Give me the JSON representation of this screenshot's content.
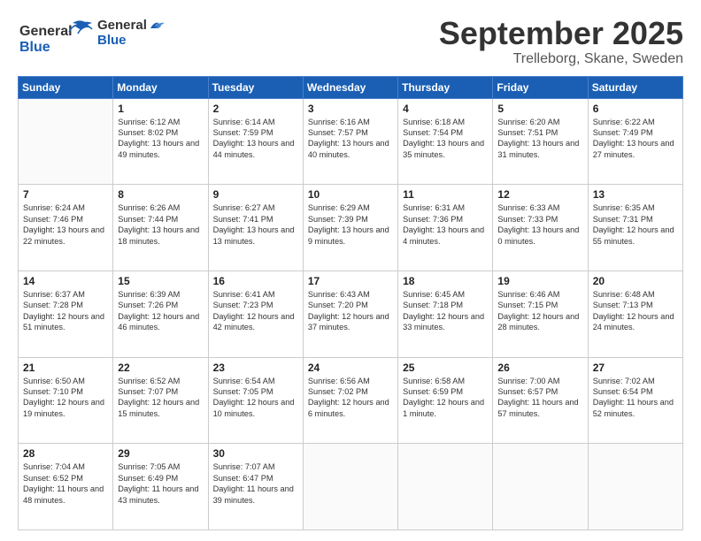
{
  "header": {
    "logo_general": "General",
    "logo_blue": "Blue",
    "month_title": "September 2025",
    "subtitle": "Trelleborg, Skane, Sweden"
  },
  "weekdays": [
    "Sunday",
    "Monday",
    "Tuesday",
    "Wednesday",
    "Thursday",
    "Friday",
    "Saturday"
  ],
  "weeks": [
    [
      {
        "day": "",
        "sunrise": "",
        "sunset": "",
        "daylight": ""
      },
      {
        "day": "1",
        "sunrise": "Sunrise: 6:12 AM",
        "sunset": "Sunset: 8:02 PM",
        "daylight": "Daylight: 13 hours and 49 minutes."
      },
      {
        "day": "2",
        "sunrise": "Sunrise: 6:14 AM",
        "sunset": "Sunset: 7:59 PM",
        "daylight": "Daylight: 13 hours and 44 minutes."
      },
      {
        "day": "3",
        "sunrise": "Sunrise: 6:16 AM",
        "sunset": "Sunset: 7:57 PM",
        "daylight": "Daylight: 13 hours and 40 minutes."
      },
      {
        "day": "4",
        "sunrise": "Sunrise: 6:18 AM",
        "sunset": "Sunset: 7:54 PM",
        "daylight": "Daylight: 13 hours and 35 minutes."
      },
      {
        "day": "5",
        "sunrise": "Sunrise: 6:20 AM",
        "sunset": "Sunset: 7:51 PM",
        "daylight": "Daylight: 13 hours and 31 minutes."
      },
      {
        "day": "6",
        "sunrise": "Sunrise: 6:22 AM",
        "sunset": "Sunset: 7:49 PM",
        "daylight": "Daylight: 13 hours and 27 minutes."
      }
    ],
    [
      {
        "day": "7",
        "sunrise": "Sunrise: 6:24 AM",
        "sunset": "Sunset: 7:46 PM",
        "daylight": "Daylight: 13 hours and 22 minutes."
      },
      {
        "day": "8",
        "sunrise": "Sunrise: 6:26 AM",
        "sunset": "Sunset: 7:44 PM",
        "daylight": "Daylight: 13 hours and 18 minutes."
      },
      {
        "day": "9",
        "sunrise": "Sunrise: 6:27 AM",
        "sunset": "Sunset: 7:41 PM",
        "daylight": "Daylight: 13 hours and 13 minutes."
      },
      {
        "day": "10",
        "sunrise": "Sunrise: 6:29 AM",
        "sunset": "Sunset: 7:39 PM",
        "daylight": "Daylight: 13 hours and 9 minutes."
      },
      {
        "day": "11",
        "sunrise": "Sunrise: 6:31 AM",
        "sunset": "Sunset: 7:36 PM",
        "daylight": "Daylight: 13 hours and 4 minutes."
      },
      {
        "day": "12",
        "sunrise": "Sunrise: 6:33 AM",
        "sunset": "Sunset: 7:33 PM",
        "daylight": "Daylight: 13 hours and 0 minutes."
      },
      {
        "day": "13",
        "sunrise": "Sunrise: 6:35 AM",
        "sunset": "Sunset: 7:31 PM",
        "daylight": "Daylight: 12 hours and 55 minutes."
      }
    ],
    [
      {
        "day": "14",
        "sunrise": "Sunrise: 6:37 AM",
        "sunset": "Sunset: 7:28 PM",
        "daylight": "Daylight: 12 hours and 51 minutes."
      },
      {
        "day": "15",
        "sunrise": "Sunrise: 6:39 AM",
        "sunset": "Sunset: 7:26 PM",
        "daylight": "Daylight: 12 hours and 46 minutes."
      },
      {
        "day": "16",
        "sunrise": "Sunrise: 6:41 AM",
        "sunset": "Sunset: 7:23 PM",
        "daylight": "Daylight: 12 hours and 42 minutes."
      },
      {
        "day": "17",
        "sunrise": "Sunrise: 6:43 AM",
        "sunset": "Sunset: 7:20 PM",
        "daylight": "Daylight: 12 hours and 37 minutes."
      },
      {
        "day": "18",
        "sunrise": "Sunrise: 6:45 AM",
        "sunset": "Sunset: 7:18 PM",
        "daylight": "Daylight: 12 hours and 33 minutes."
      },
      {
        "day": "19",
        "sunrise": "Sunrise: 6:46 AM",
        "sunset": "Sunset: 7:15 PM",
        "daylight": "Daylight: 12 hours and 28 minutes."
      },
      {
        "day": "20",
        "sunrise": "Sunrise: 6:48 AM",
        "sunset": "Sunset: 7:13 PM",
        "daylight": "Daylight: 12 hours and 24 minutes."
      }
    ],
    [
      {
        "day": "21",
        "sunrise": "Sunrise: 6:50 AM",
        "sunset": "Sunset: 7:10 PM",
        "daylight": "Daylight: 12 hours and 19 minutes."
      },
      {
        "day": "22",
        "sunrise": "Sunrise: 6:52 AM",
        "sunset": "Sunset: 7:07 PM",
        "daylight": "Daylight: 12 hours and 15 minutes."
      },
      {
        "day": "23",
        "sunrise": "Sunrise: 6:54 AM",
        "sunset": "Sunset: 7:05 PM",
        "daylight": "Daylight: 12 hours and 10 minutes."
      },
      {
        "day": "24",
        "sunrise": "Sunrise: 6:56 AM",
        "sunset": "Sunset: 7:02 PM",
        "daylight": "Daylight: 12 hours and 6 minutes."
      },
      {
        "day": "25",
        "sunrise": "Sunrise: 6:58 AM",
        "sunset": "Sunset: 6:59 PM",
        "daylight": "Daylight: 12 hours and 1 minute."
      },
      {
        "day": "26",
        "sunrise": "Sunrise: 7:00 AM",
        "sunset": "Sunset: 6:57 PM",
        "daylight": "Daylight: 11 hours and 57 minutes."
      },
      {
        "day": "27",
        "sunrise": "Sunrise: 7:02 AM",
        "sunset": "Sunset: 6:54 PM",
        "daylight": "Daylight: 11 hours and 52 minutes."
      }
    ],
    [
      {
        "day": "28",
        "sunrise": "Sunrise: 7:04 AM",
        "sunset": "Sunset: 6:52 PM",
        "daylight": "Daylight: 11 hours and 48 minutes."
      },
      {
        "day": "29",
        "sunrise": "Sunrise: 7:05 AM",
        "sunset": "Sunset: 6:49 PM",
        "daylight": "Daylight: 11 hours and 43 minutes."
      },
      {
        "day": "30",
        "sunrise": "Sunrise: 7:07 AM",
        "sunset": "Sunset: 6:47 PM",
        "daylight": "Daylight: 11 hours and 39 minutes."
      },
      {
        "day": "",
        "sunrise": "",
        "sunset": "",
        "daylight": ""
      },
      {
        "day": "",
        "sunrise": "",
        "sunset": "",
        "daylight": ""
      },
      {
        "day": "",
        "sunrise": "",
        "sunset": "",
        "daylight": ""
      },
      {
        "day": "",
        "sunrise": "",
        "sunset": "",
        "daylight": ""
      }
    ]
  ]
}
